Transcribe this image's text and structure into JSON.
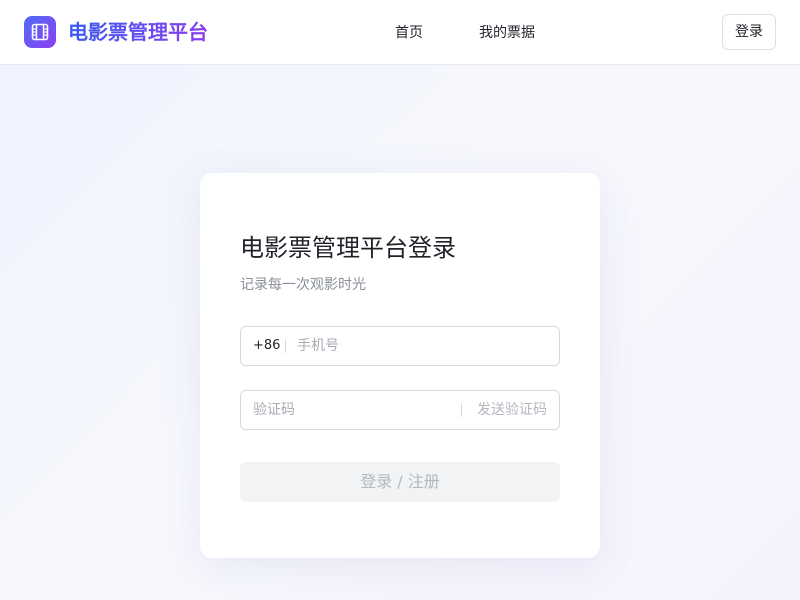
{
  "header": {
    "brand": "电影票管理平台",
    "nav": [
      {
        "label": "首页"
      },
      {
        "label": "我的票据"
      }
    ],
    "login_label": "登录",
    "logo_icon": "film-icon"
  },
  "login_card": {
    "title": "电影票管理平台登录",
    "subtitle": "记录每一次观影时光",
    "phone": {
      "prefix": "+86",
      "placeholder": "手机号",
      "value": ""
    },
    "code": {
      "placeholder": "验证码",
      "value": "",
      "send_label": "发送验证码"
    },
    "submit_label": "登录 / 注册"
  },
  "colors": {
    "brand_start": "#4f6cf7",
    "brand_end": "#8b3ff2",
    "disabled_text": "#b4b8bf",
    "disabled_bg": "#f2f3f5"
  }
}
